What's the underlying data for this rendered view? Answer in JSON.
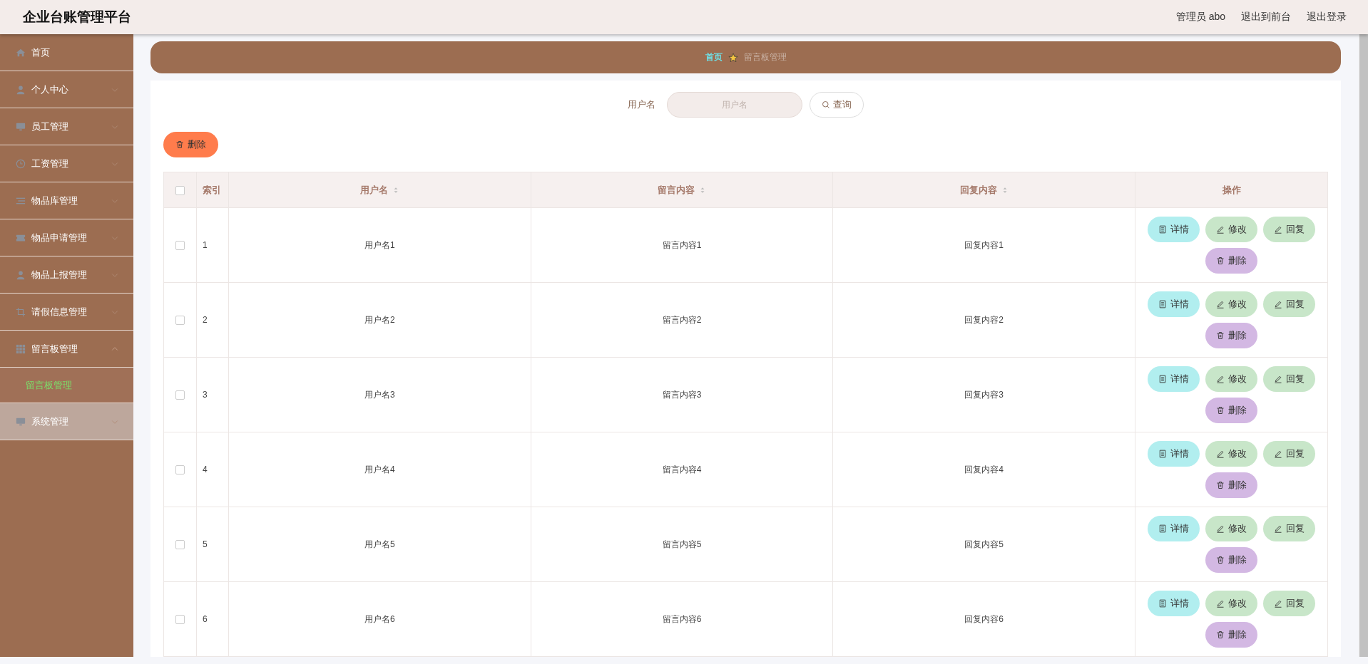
{
  "header": {
    "title": "企业台账管理平台",
    "links": [
      "管理员 abo",
      "退出到前台",
      "退出登录"
    ]
  },
  "sidebar": {
    "items": [
      {
        "label": "首页",
        "kind": "home",
        "hovered": false
      },
      {
        "label": "个人中心",
        "kind": "user",
        "expanded": false,
        "hovered": false
      },
      {
        "label": "员工管理",
        "kind": "monitor",
        "expanded": false,
        "hovered": false
      },
      {
        "label": "工资管理",
        "kind": "clock",
        "expanded": false,
        "hovered": false
      },
      {
        "label": "物品库管理",
        "kind": "list",
        "expanded": false,
        "hovered": false
      },
      {
        "label": "物品申请管理",
        "kind": "ticket",
        "expanded": false,
        "hovered": false
      },
      {
        "label": "物品上报管理",
        "kind": "user",
        "expanded": false,
        "hovered": false
      },
      {
        "label": "请假信息管理",
        "kind": "crop",
        "expanded": false,
        "hovered": false
      },
      {
        "label": "留言板管理",
        "kind": "grid",
        "expanded": true,
        "hovered": false,
        "children": [
          {
            "label": "留言板管理",
            "selected": true
          }
        ]
      },
      {
        "label": "系统管理",
        "kind": "monitor",
        "expanded": false,
        "hovered": true
      }
    ]
  },
  "breadcrumb": [
    {
      "label": "首页",
      "current": false
    },
    {
      "label": "留言板管理",
      "current": true
    }
  ],
  "search": {
    "label": "用户名",
    "placeholder": "用户名",
    "button": "查询"
  },
  "delete_button": "删除",
  "table": {
    "all_checked": false,
    "columns": [
      {
        "label": "索引"
      },
      {
        "label": "用户名",
        "sortable": true
      },
      {
        "label": "留言内容",
        "sortable": true
      },
      {
        "label": "回复内容",
        "sortable": true
      },
      {
        "label": "操作"
      }
    ],
    "rows": [
      {
        "checked": false,
        "cells": [
          "1",
          "用户名1",
          "留言内容1",
          "回复内容1"
        ],
        "actions": [
          {
            "kind": "detail",
            "label": "详情"
          },
          {
            "kind": "edit",
            "label": "修改"
          },
          {
            "kind": "reply",
            "label": "回复"
          },
          {
            "kind": "delete",
            "label": "删除"
          }
        ]
      },
      {
        "checked": false,
        "cells": [
          "2",
          "用户名2",
          "留言内容2",
          "回复内容2"
        ],
        "actions": [
          {
            "kind": "detail",
            "label": "详情"
          },
          {
            "kind": "edit",
            "label": "修改"
          },
          {
            "kind": "reply",
            "label": "回复"
          },
          {
            "kind": "delete",
            "label": "删除"
          }
        ]
      },
      {
        "checked": false,
        "cells": [
          "3",
          "用户名3",
          "留言内容3",
          "回复内容3"
        ],
        "actions": [
          {
            "kind": "detail",
            "label": "详情"
          },
          {
            "kind": "edit",
            "label": "修改"
          },
          {
            "kind": "reply",
            "label": "回复"
          },
          {
            "kind": "delete",
            "label": "删除"
          }
        ]
      },
      {
        "checked": false,
        "cells": [
          "4",
          "用户名4",
          "留言内容4",
          "回复内容4"
        ],
        "actions": [
          {
            "kind": "detail",
            "label": "详情"
          },
          {
            "kind": "edit",
            "label": "修改"
          },
          {
            "kind": "reply",
            "label": "回复"
          },
          {
            "kind": "delete",
            "label": "删除"
          }
        ]
      },
      {
        "checked": false,
        "cells": [
          "5",
          "用户名5",
          "留言内容5",
          "回复内容5"
        ],
        "actions": [
          {
            "kind": "detail",
            "label": "详情"
          },
          {
            "kind": "edit",
            "label": "修改"
          },
          {
            "kind": "reply",
            "label": "回复"
          },
          {
            "kind": "delete",
            "label": "删除"
          }
        ]
      },
      {
        "checked": false,
        "cells": [
          "6",
          "用户名6",
          "留言内容6",
          "回复内容6"
        ],
        "actions": [
          {
            "kind": "detail",
            "label": "详情"
          },
          {
            "kind": "edit",
            "label": "修改"
          },
          {
            "kind": "reply",
            "label": "回复"
          },
          {
            "kind": "delete",
            "label": "删除"
          }
        ]
      }
    ]
  }
}
